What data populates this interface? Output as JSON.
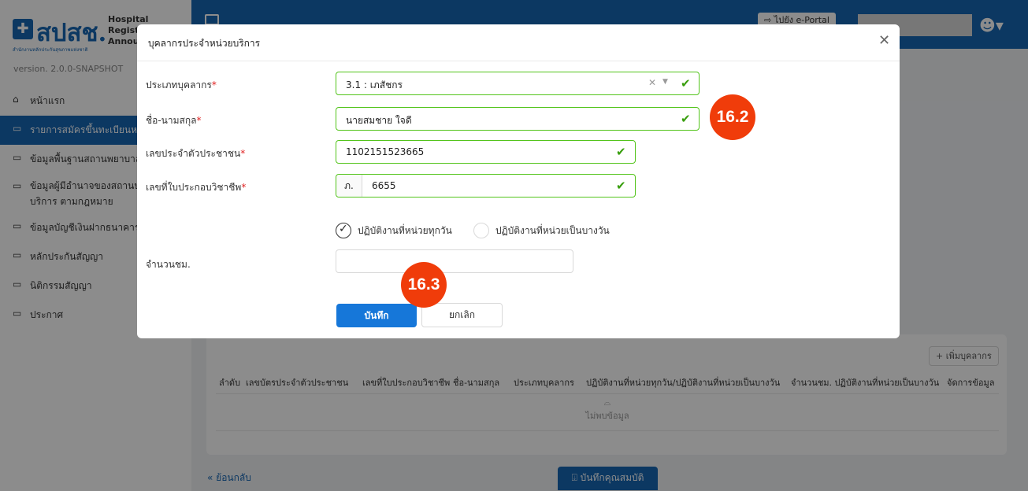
{
  "brand": {
    "logo_text": "สปสช.",
    "logo_subtext": "สำนักงานหลักประกันสุขภาพแห่งชาติ",
    "title_lines": [
      "Hospital",
      "Regist",
      "Annou"
    ],
    "version": "version. 2.0.0-SNAPSHOT"
  },
  "sidebar": {
    "items": [
      {
        "label": "หน้าแรก",
        "icon": "home-icon"
      },
      {
        "label": "รายการสมัครขึ้นทะเบียนหน่ว",
        "icon": "table-icon",
        "active": true
      },
      {
        "label": "ข้อมูลพื้นฐานสถานพยาบาล",
        "icon": "table-icon"
      },
      {
        "label": "ข้อมูลผู้มีอำนาจของสถานบ หน่วยบริการ ตามกฎหมาย",
        "icon": "table-icon"
      },
      {
        "label": "ข้อมูลบัญชีเงินฝากธนาคาร",
        "icon": "table-icon"
      },
      {
        "label": "หลักประกันสัญญา",
        "icon": "table-icon"
      },
      {
        "label": "นิติกรรมสัญญา",
        "icon": "table-icon"
      },
      {
        "label": "ประกาศ",
        "icon": "table-icon"
      }
    ]
  },
  "topbar": {
    "portal_label": "⇨ ไปยัง e-Portal"
  },
  "content": {
    "add_staff_label": "+ เพิ่มบุคลากร",
    "table_columns": [
      "ลำดับ",
      "เลขบัตรประจำตัวประชาชน",
      "เลขที่ใบประกอบวิชาชีพ",
      "ชื่อ-นามสกุล",
      "ประเภทบุคลากร",
      "ปฏิบัติงานที่หน่วยทุกวัน/ปฏิบัติงานที่หน่วยเป็นบางวัน",
      "จำนวนชม. ปฏิบัติงานที่หน่วยเป็นบางวัน",
      "จัดการข้อมูล"
    ],
    "empty_text": "ไม่พบข้อมูล",
    "back_label": "« ย้อนกลับ",
    "save_profile_label": "บันทึกคุณสมบัติ"
  },
  "modal": {
    "title": "บุคลากรประจำหน่วยบริการ",
    "fields": {
      "staff_type": {
        "label": "ประเภทบุคลากร",
        "value": "3.1 : เภสัชกร"
      },
      "fullname": {
        "label": "ชื่อ-นามสกุล",
        "value": "นายสมชาย ใจดี"
      },
      "citizen_id": {
        "label": "เลขประจำตัวประชาชน",
        "value": "1102151523665"
      },
      "license": {
        "label": "เลขที่ใบประกอบวิชาชีพ",
        "prefix": "ภ.",
        "value": "6655"
      },
      "workday": {
        "options": [
          "ปฏิบัติงานที่หน่วยทุกวัน",
          "ปฏิบัติงานที่หน่วยเป็นบางวัน"
        ],
        "selected": "ปฏิบัติงานที่หน่วยทุกวัน"
      },
      "hours": {
        "label": "จำนวนชม.",
        "value": ""
      }
    },
    "required_mark": "*",
    "save_label": "บันทึก",
    "cancel_label": "ยกเลิก"
  },
  "annotations": {
    "badge_1": "16.2",
    "badge_2": "16.3"
  },
  "colors": {
    "primary": "#1766b3",
    "button": "#1677d9",
    "valid": "#52c41a",
    "badge": "#f03c0a"
  }
}
